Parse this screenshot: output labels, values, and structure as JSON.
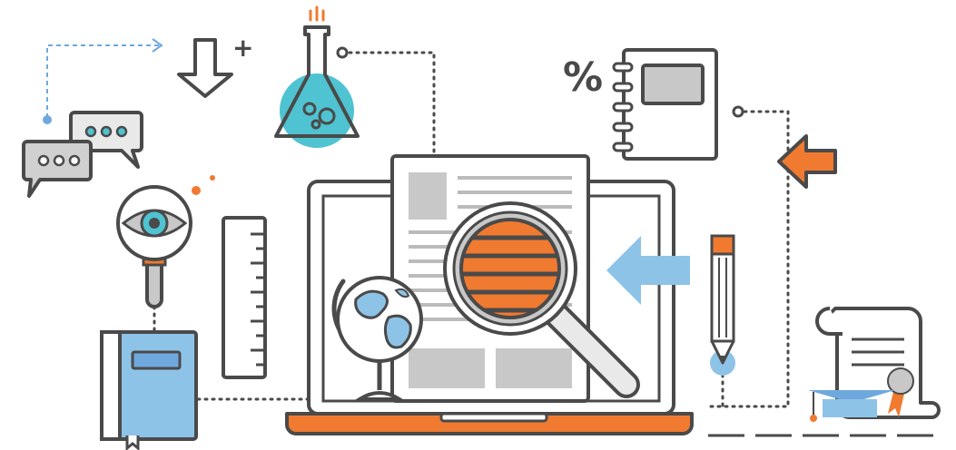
{
  "illustration": {
    "percent_glyph": "%",
    "plus_glyph": "+",
    "colors": {
      "outline": "#4a4a4a",
      "orange": "#f07a30",
      "blue": "#6fa8dc",
      "teal": "#4fc3d1",
      "gray_fill": "#c8c8c8",
      "light_blue": "#8ec3e8"
    },
    "icons": [
      "chat-bubbles-icon",
      "download-plus-icon",
      "flask-icon",
      "notebook-percent-icon",
      "eye-magnifier-icon",
      "ruler-icon",
      "book-icon",
      "laptop-icon",
      "document-icon",
      "magnifying-glass-icon",
      "globe-icon",
      "arrow-left-blue-icon",
      "arrow-left-orange-icon",
      "pencil-icon",
      "diploma-scroll-icon",
      "graduation-cap-icon"
    ]
  }
}
